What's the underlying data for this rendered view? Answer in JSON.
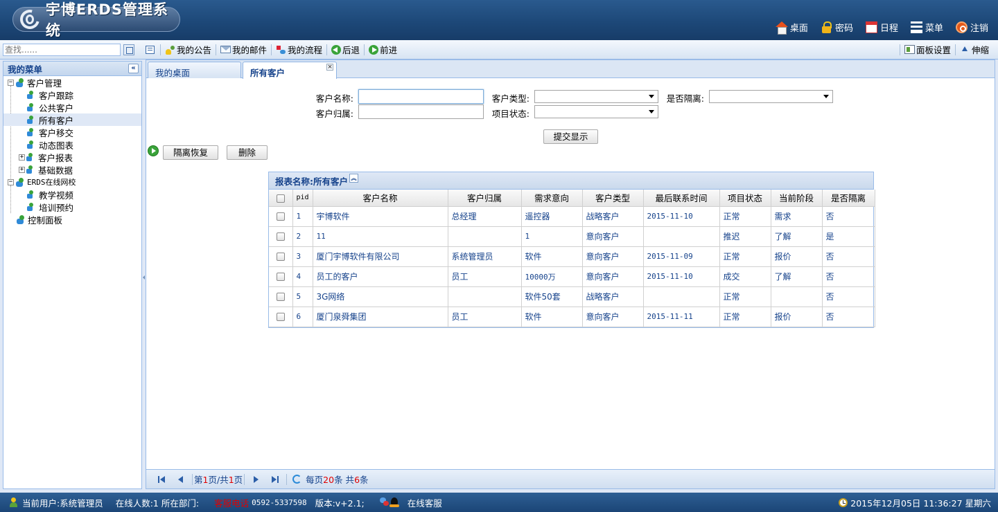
{
  "header": {
    "logo_text": "宇博ERDS管理系统",
    "nav": [
      {
        "label": "桌面",
        "icon": "home-icon"
      },
      {
        "label": "密码",
        "icon": "lock-icon"
      },
      {
        "label": "日程",
        "icon": "calendar-icon"
      },
      {
        "label": "菜单",
        "icon": "menu-icon"
      },
      {
        "label": "注销",
        "icon": "logout-icon"
      }
    ]
  },
  "toolbar": {
    "search_placeholder": "查找......",
    "items": [
      {
        "label": "我的公告",
        "icon": "notice-icon"
      },
      {
        "label": "我的邮件",
        "icon": "mail-icon"
      },
      {
        "label": "我的流程",
        "icon": "workflow-icon"
      },
      {
        "label": "后退",
        "icon": "back-icon"
      },
      {
        "label": "前进",
        "icon": "forward-icon"
      }
    ],
    "panel_settings": "面板设置",
    "collapse": "伸缩"
  },
  "sidebar": {
    "title": "我的菜单",
    "tree": [
      {
        "label": "客户管理",
        "toggle": "−",
        "children": [
          {
            "label": "客户跟踪"
          },
          {
            "label": "公共客户"
          },
          {
            "label": "所有客户",
            "selected": true
          },
          {
            "label": "客户移交"
          },
          {
            "label": "动态图表"
          },
          {
            "label": "客户报表",
            "toggle": "+"
          },
          {
            "label": "基础数据",
            "toggle": "+"
          }
        ]
      },
      {
        "label": "ERDS在线网校",
        "toggle": "−",
        "children": [
          {
            "label": "教学视频"
          },
          {
            "label": "培训预约"
          }
        ]
      },
      {
        "label": "控制面板"
      }
    ]
  },
  "tabs": [
    {
      "label": "我的桌面",
      "active": false
    },
    {
      "label": "所有客户",
      "active": true
    }
  ],
  "form": {
    "customer_name_label": "客户名称:",
    "customer_owner_label": "客户归属:",
    "customer_type_label": "客户类型:",
    "project_status_label": "项目状态:",
    "isolated_label": "是否隔离:",
    "submit_label": "提交显示",
    "restore_label": "隔离恢复",
    "delete_label": "删除"
  },
  "grid": {
    "title": "报表名称:所有客户",
    "columns": [
      "pid",
      "客户名称",
      "客户归属",
      "需求意向",
      "客户类型",
      "最后联系时间",
      "项目状态",
      "当前阶段",
      "是否隔离"
    ],
    "rows": [
      [
        "1",
        "宇博软件",
        "总经理",
        "遥控器",
        "战略客户",
        "2015-11-10",
        "正常",
        "需求",
        "否"
      ],
      [
        "2",
        "11",
        "",
        "1",
        "意向客户",
        "",
        "推迟",
        "了解",
        "是"
      ],
      [
        "3",
        "厦门宇博软件有限公司",
        "系统管理员",
        "软件",
        "意向客户",
        "2015-11-09",
        "正常",
        "报价",
        "否"
      ],
      [
        "4",
        "员工的客户",
        "员工",
        "10000万",
        "意向客户",
        "2015-11-10",
        "成交",
        "了解",
        "否"
      ],
      [
        "5",
        "3G网络",
        "",
        "软件50套",
        "战略客户",
        "",
        "正常",
        "",
        "否"
      ],
      [
        "6",
        "厦门泉舜集团",
        "员工",
        "软件",
        "意向客户",
        "2015-11-11",
        "正常",
        "报价",
        "否"
      ]
    ]
  },
  "pager": {
    "page_prefix": "第",
    "current_page": "1",
    "page_mid": "页/共",
    "total_pages": "1",
    "page_suffix": "页",
    "per_page_prefix": "每页",
    "per_page": "20",
    "per_page_mid": "条 共",
    "total": "6",
    "total_suffix": "条"
  },
  "status": {
    "current_user": "当前用户:系统管理员",
    "online_count": "在线人数:1 所在部门:",
    "hotline_label": "客服电话",
    "phone": "0592-5337598",
    "version": "版本:v+2.1;",
    "online_service": "在线客服",
    "datetime": "2015年12月05日 11:36:27 星期六"
  }
}
